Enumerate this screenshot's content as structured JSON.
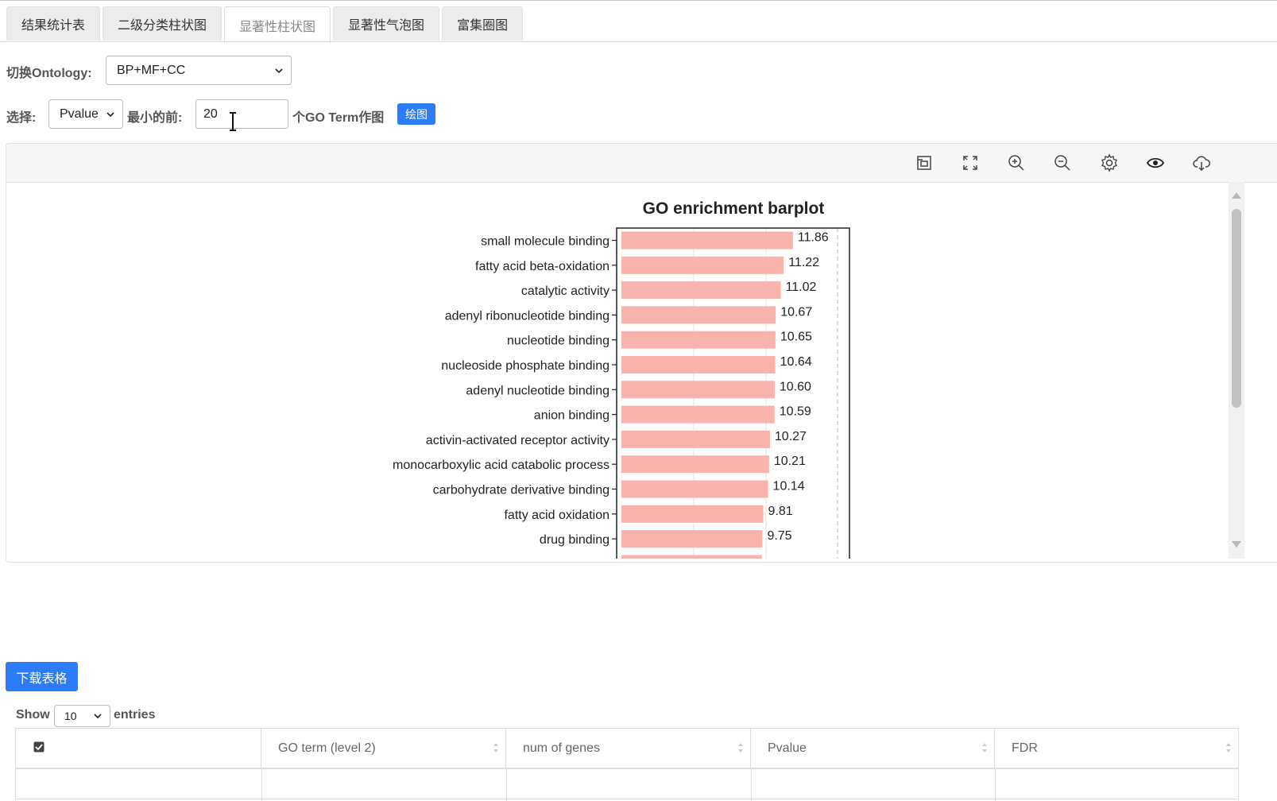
{
  "tabs": [
    "结果统计表",
    "二级分类柱状图",
    "显著性柱状图",
    "显著性气泡图",
    "富集圈图"
  ],
  "active_tab": 2,
  "ontology": {
    "label": "切换Ontology:",
    "value": "BP+MF+CC"
  },
  "select_row": {
    "label": "选择:",
    "metric": "Pvalue",
    "min_label": "最小的前:",
    "count": "20",
    "suffix": "个GO Term作图",
    "plot_button": "绘图"
  },
  "toolbar_icons": [
    "restore-icon",
    "fullscreen-icon",
    "zoom-in-icon",
    "zoom-out-icon",
    "settings-icon",
    "eye-icon",
    "cloud-download-icon"
  ],
  "chart_data": {
    "type": "bar",
    "orientation": "horizontal",
    "title": "GO enrichment barplot",
    "categories": [
      "small molecule binding",
      "fatty acid beta-oxidation",
      "catalytic activity",
      "adenyl ribonucleotide binding",
      "nucleotide binding",
      "nucleoside phosphate binding",
      "adenyl nucleotide binding",
      "anion binding",
      "activin-activated receptor activity",
      "monocarboxylic acid catabolic process",
      "carbohydrate derivative binding",
      "fatty acid oxidation",
      "drug binding"
    ],
    "values": [
      11.86,
      11.22,
      11.02,
      10.67,
      10.65,
      10.64,
      10.6,
      10.59,
      10.27,
      10.21,
      10.14,
      9.81,
      9.75
    ],
    "value_labels": [
      "11.86",
      "11.22",
      "11.02",
      "10.67",
      "10.65",
      "10.64",
      "10.60",
      "10.59",
      "10.27",
      "10.21",
      "10.14",
      "9.81",
      "9.75"
    ],
    "xlim": [
      0,
      16
    ],
    "grid": true,
    "bar_color": "#f8b3ad"
  },
  "download_button": "下载表格",
  "show": {
    "before": "Show",
    "value": "10",
    "after": "entries"
  },
  "table_headers": [
    "GO term (level 2)",
    "num of genes",
    "Pvalue",
    "FDR"
  ],
  "colors": {
    "accent": "#2b7cf6",
    "bar": "#f8b3ad"
  }
}
